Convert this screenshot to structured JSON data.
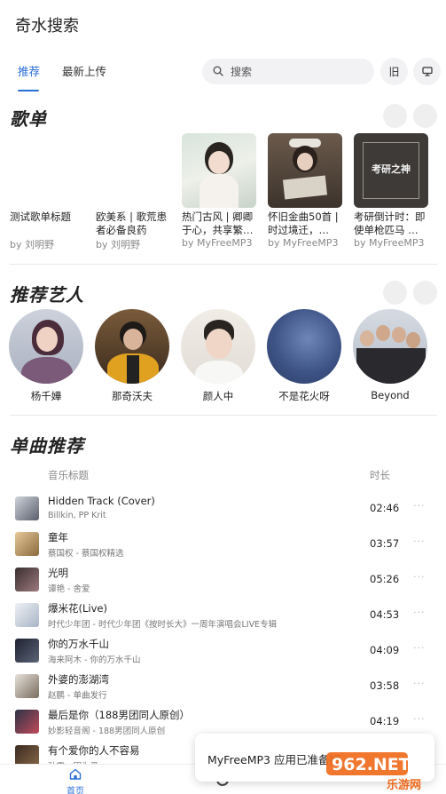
{
  "app": {
    "title": "奇水搜索"
  },
  "tabs": [
    {
      "label": "推荐",
      "active": true
    },
    {
      "label": "最新上传",
      "active": false
    }
  ],
  "search": {
    "placeholder": "搜索"
  },
  "header_buttons": {
    "history_label": "旧"
  },
  "sections": {
    "playlists": "歌单",
    "artists": "推荐艺人",
    "songs": "单曲推荐"
  },
  "playlists": [
    {
      "title": "测试歌单标题",
      "by": "by 刘明野",
      "cover": "none"
    },
    {
      "title": "欧美系 | 歌荒患者必备良药",
      "by": "by 刘明野",
      "cover": "none"
    },
    {
      "title": "热门古风 | 卿卿于心，共享繁…",
      "by": "by MyFreeMP3",
      "cover": "girl-photo"
    },
    {
      "title": "怀旧金曲50首 | 时过境迁，…",
      "by": "by MyFreeMP3",
      "cover": "reading-photo"
    },
    {
      "title": "考研倒计时：即使单枪匹马 …",
      "by": "by MyFreeMP3",
      "cover": "exam-poster",
      "cover_text": "考研之神"
    }
  ],
  "artists": [
    {
      "name": "杨千嬅"
    },
    {
      "name": "那奇沃夫"
    },
    {
      "name": "颜人中"
    },
    {
      "name": "不是花火呀"
    },
    {
      "name": "Beyond"
    }
  ],
  "song_table": {
    "col_title": "音乐标题",
    "col_duration": "时长",
    "more_glyph": "···"
  },
  "songs": [
    {
      "title": "Hidden Track (Cover)",
      "sub": "Billkin, PP Krit",
      "duration": "02:46"
    },
    {
      "title": "童年",
      "sub": "蔡国权 - 蔡国权精选",
      "duration": "03:57"
    },
    {
      "title": "光明",
      "sub": "谭艳 - 舍爱",
      "duration": "05:26"
    },
    {
      "title": "爆米花(Live)",
      "sub": "时代少年团 - 时代少年团《按时长大》一周年演唱会LIVE专辑",
      "duration": "04:53"
    },
    {
      "title": "你的万水千山",
      "sub": "海来阿木 - 你的万水千山",
      "duration": "04:09"
    },
    {
      "title": "外婆的澎湖湾",
      "sub": "赵鹏 - 单曲发行",
      "duration": "03:58"
    },
    {
      "title": "最后是你（188男团同人原创）",
      "sub": "妙影轻音阁 - 188男团同人原创",
      "duration": "04:19"
    },
    {
      "title": "有个爱你的人不容易",
      "sub": "孙露 - 因为爱",
      "duration": ""
    }
  ],
  "bottom_nav": {
    "home_label": "首页"
  },
  "toast": {
    "text": "MyFreeMP3 应用已准备好"
  },
  "watermark": {
    "text": "962.NET",
    "sub": "乐游网"
  },
  "colors": {
    "accent": "#2b6fd6",
    "watermark": "#f06a1c"
  }
}
